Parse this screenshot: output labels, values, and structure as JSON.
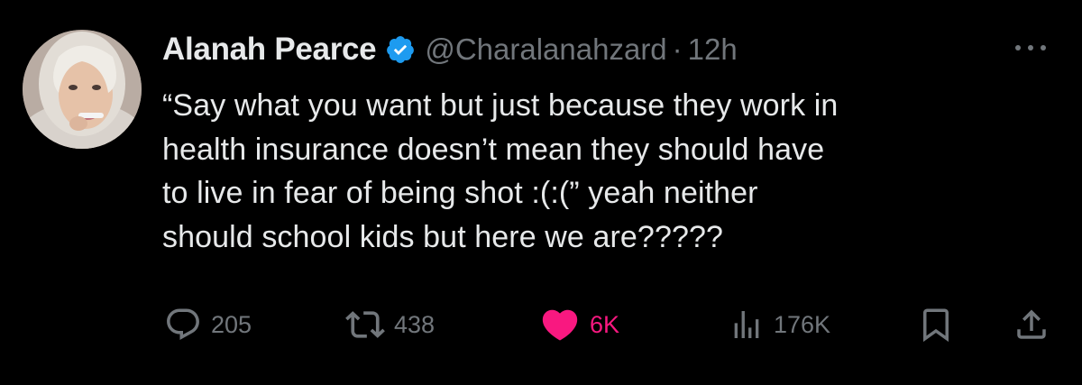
{
  "tweet": {
    "author": {
      "display_name": "Alanah Pearce",
      "handle": "@Charalanahzard",
      "verified": true
    },
    "separator": "·",
    "timestamp": "12h",
    "text_lines": [
      "“Say what you want but just because they work in",
      "health insurance doesn’t mean they should have",
      "to live in fear of being shot :(:(” yeah neither",
      "should school kids but here we are?????"
    ],
    "actions": {
      "replies": "205",
      "retweets": "438",
      "likes": "6K",
      "views": "176K"
    },
    "liked": true
  },
  "icons": {
    "verified": "verified-badge-icon",
    "more": "more-horizontal-icon",
    "reply": "reply-icon",
    "retweet": "retweet-icon",
    "like": "heart-icon",
    "views": "views-icon",
    "bookmark": "bookmark-icon",
    "share": "share-icon"
  },
  "colors": {
    "background": "#000000",
    "text": "#e7e9ea",
    "muted": "#71767b",
    "verified": "#1d9bf0",
    "like": "#f91880"
  }
}
